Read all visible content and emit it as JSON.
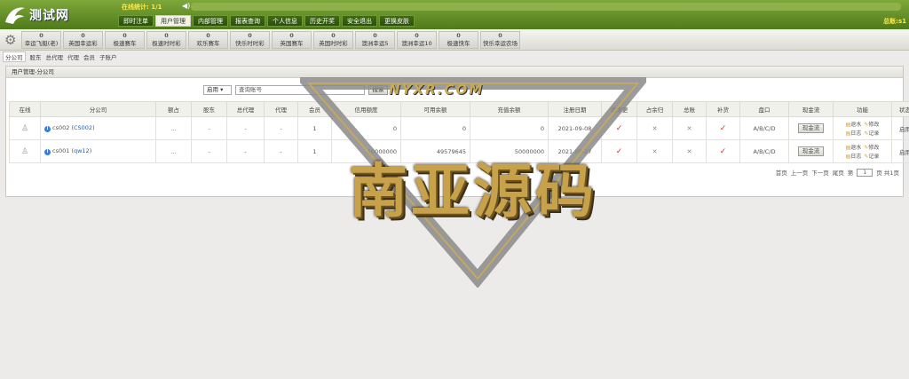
{
  "header": {
    "logo_text": "测试网",
    "online_label": "在线统计: 1/1",
    "total_label": "总账:s1",
    "nav": [
      {
        "label": "即时注单",
        "active": false
      },
      {
        "label": "用户管理",
        "active": true
      },
      {
        "label": "内部管理",
        "active": false
      },
      {
        "label": "报表查询",
        "active": false
      },
      {
        "label": "个人信息",
        "active": false
      },
      {
        "label": "历史开奖",
        "active": false
      },
      {
        "label": "安全退出",
        "active": false
      },
      {
        "label": "更换皮肤",
        "active": false
      }
    ]
  },
  "games": [
    {
      "count": "0",
      "label": "幸运飞艇(老)"
    },
    {
      "count": "0",
      "label": "英国幸运彩"
    },
    {
      "count": "0",
      "label": "极速赛车"
    },
    {
      "count": "0",
      "label": "极速时时彩"
    },
    {
      "count": "0",
      "label": "欢乐赛车"
    },
    {
      "count": "0",
      "label": "快乐时时彩"
    },
    {
      "count": "0",
      "label": "英国赛车"
    },
    {
      "count": "0",
      "label": "英国时时彩"
    },
    {
      "count": "0",
      "label": "澳洲幸运5"
    },
    {
      "count": "0",
      "label": "澳洲幸运10"
    },
    {
      "count": "0",
      "label": "极速快车"
    },
    {
      "count": "0",
      "label": "快乐幸运农场"
    }
  ],
  "subnav": [
    "分公司",
    "股东",
    "总代理",
    "代理",
    "会员",
    "子账户"
  ],
  "breadcrumb": "用户管理-分公司",
  "filter": {
    "status_value": "启用",
    "search_placeholder": "查询账号",
    "search_label": "搜索"
  },
  "table": {
    "headers": [
      "在线",
      "分公司",
      "额占",
      "股东",
      "总代理",
      "代理",
      "会员",
      "信用额度",
      "可用余额",
      "充值余额",
      "注册日期",
      "调率更",
      "占余归",
      "总账",
      "补货",
      "盘口",
      "现金流",
      "功能",
      "状态"
    ],
    "rows": [
      {
        "account": "cs002",
        "alias": "CS002",
        "share": "...",
        "holder": "-",
        "general_agent": "-",
        "agent": "-",
        "members": "1",
        "credit": "0",
        "available": "0",
        "recharge": "0",
        "reg_date": "2021-09-08",
        "rate_change": true,
        "remain": false,
        "total": false,
        "replenish": true,
        "handicap": "A/B/C/D",
        "cash_label": "现金流",
        "funcs": [
          "退水",
          "修改",
          "日志",
          "记录"
        ],
        "status": "启用"
      },
      {
        "account": "cs001",
        "alias": "qw12",
        "share": "...",
        "holder": "-",
        "general_agent": "-",
        "agent": "-",
        "members": "1",
        "credit": "50000000",
        "available": "49579645",
        "recharge": "50000000",
        "reg_date": "2021-05-27",
        "rate_change": true,
        "remain": false,
        "total": false,
        "replenish": true,
        "handicap": "A/B/C/D",
        "cash_label": "现金流",
        "funcs": [
          "退水",
          "修改",
          "日志",
          "记录"
        ],
        "status": "启用"
      }
    ]
  },
  "pager": {
    "first": "首页",
    "prev": "上一页",
    "next": "下一页",
    "last": "尾页",
    "page_prefix": "第",
    "page_value": "1",
    "page_suffix": "页 共1页"
  },
  "watermark": {
    "url": "NYXR.COM",
    "text": "南亚源码"
  },
  "colors": {
    "header": "#5f8a22",
    "accent": "#1f5fb0",
    "check": "#dd3333"
  }
}
